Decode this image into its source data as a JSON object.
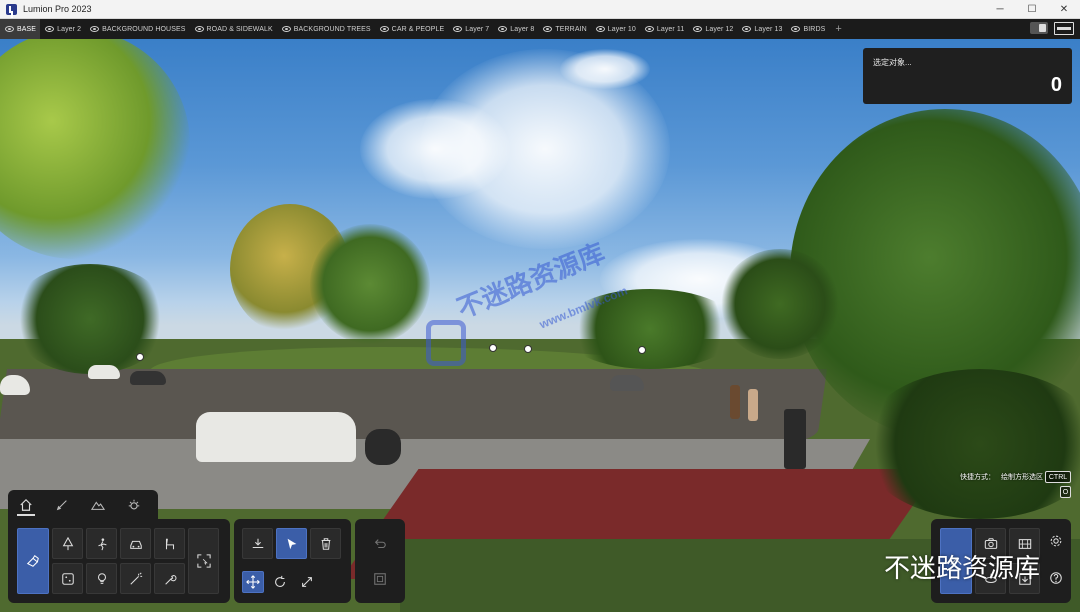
{
  "window": {
    "title": "Lumion Pro 2023",
    "minimize": "─",
    "maximize": "☐",
    "close": "✕"
  },
  "layers": [
    {
      "label": "BASE",
      "active": true
    },
    {
      "label": "Layer 2"
    },
    {
      "label": "BACKGROUND HOUSES"
    },
    {
      "label": "ROAD & SIDEWALK"
    },
    {
      "label": "BACKGROUND TREES"
    },
    {
      "label": "CAR & PEOPLE"
    },
    {
      "label": "Layer 7"
    },
    {
      "label": "Layer 8"
    },
    {
      "label": "TERRAIN"
    },
    {
      "label": "Layer 10"
    },
    {
      "label": "Layer 11"
    },
    {
      "label": "Layer 12"
    },
    {
      "label": "Layer 13"
    },
    {
      "label": "BIRDS"
    }
  ],
  "layer_add": "+",
  "selection": {
    "title": "选定对象...",
    "count": "0"
  },
  "watermark": {
    "overlay_text": "不迷路资源库",
    "url": "www.bmlvk.com",
    "bottom_text": "不迷路资源库"
  },
  "shortcut": {
    "label": "快捷方式：",
    "action": "绘制方形选区",
    "key1": "CTRL",
    "key2": "O"
  },
  "colors": {
    "accent": "#3b5ea8",
    "panel": "#1e1e1e",
    "layerbar": "#1b1b1b"
  },
  "toolbar_tabs": [
    "home-icon",
    "brush-icon",
    "mountain-icon",
    "weather-icon"
  ],
  "object_tools": [
    "place-object-icon",
    "tree-icon",
    "person-icon",
    "car-icon",
    "chair-icon",
    "dice-icon",
    "lightbulb-icon",
    "effects-icon",
    "wrench-icon",
    "select-region-icon"
  ],
  "edit_tools": [
    "place-down-icon",
    "select-arrow-icon",
    "trash-icon",
    "move-icon",
    "rotate-icon",
    "scale-icon"
  ],
  "history_tools": [
    "undo-icon",
    "group-icon"
  ],
  "mode_tools": [
    "build-mode-icon",
    "photo-mode-icon",
    "movie-mode-icon",
    "panorama-icon",
    "export-icon",
    "settings-icon",
    "help-icon"
  ]
}
